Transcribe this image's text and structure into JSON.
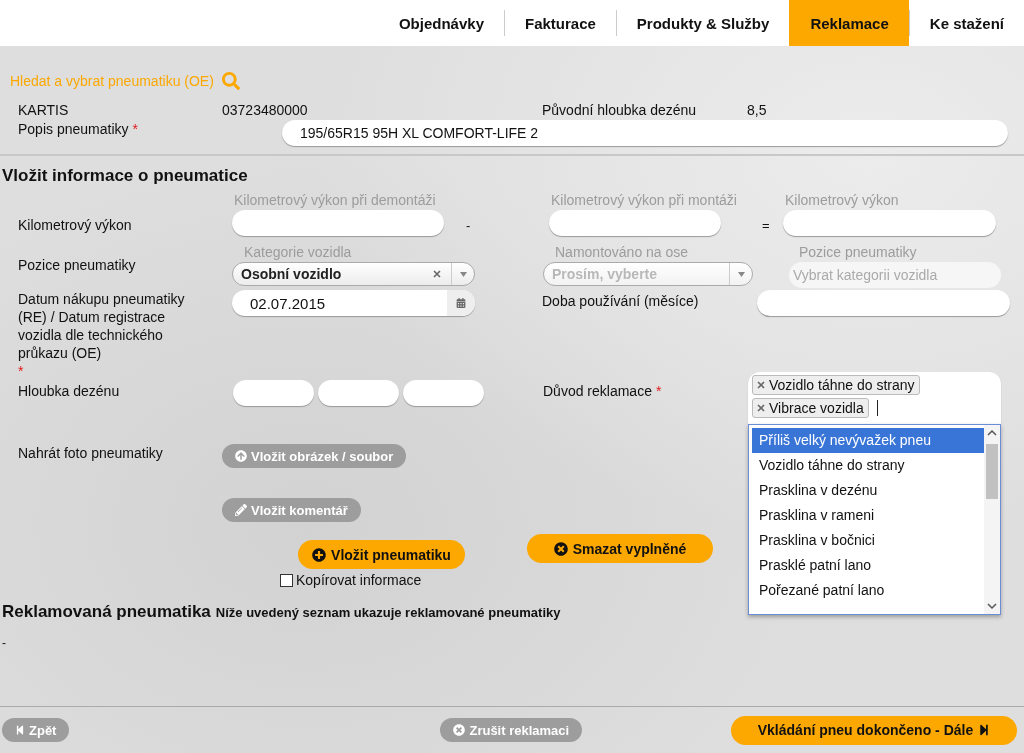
{
  "nav": {
    "tabs": [
      {
        "label": "Objednávky",
        "selected": false
      },
      {
        "label": "Fakturace",
        "selected": false
      },
      {
        "label": "Produkty & Služby",
        "selected": false
      },
      {
        "label": "Reklamace",
        "selected": true
      },
      {
        "label": "Ke stažení",
        "selected": false
      }
    ]
  },
  "search": {
    "label": "Hledat a vybrat pneumatiku (OE)"
  },
  "tire": {
    "kartis": {
      "label": "KARTIS",
      "value": "03723480000"
    },
    "original_depth": {
      "label": "Původní hloubka dezénu",
      "value": "8,5"
    },
    "description": {
      "label": "Popis pneumatiky",
      "marker": "*",
      "value": "195/65R15 95H XL COMFORT-LIFE 2"
    }
  },
  "form": {
    "title": "Vložit informace o pneumatice",
    "mileage": {
      "label": "Kilometrový výkon",
      "fields": [
        {
          "caption": "Kilometrový výkon při demontáži"
        },
        {
          "caption": "Kilometrový výkon při montáži"
        },
        {
          "caption": "Kilometrový výkon"
        }
      ],
      "operators": [
        "-",
        "="
      ]
    },
    "position": {
      "label": "Pozice pneumatiky",
      "selects": [
        {
          "caption": "Kategorie vozidla",
          "value": "Osobní vozidlo",
          "disabled": false
        },
        {
          "caption": "Namontováno na ose",
          "placeholder": "Prosím, vyberte",
          "disabled": true
        }
      ],
      "position_field": {
        "caption": "Pozice pneumatiky",
        "placeholder": "Vybrat kategorii vozidla"
      }
    },
    "purchase_date": {
      "label": "Datum nákupu pneumatiky (RE) / Datum registrace vozidla dle technického průkazu (OE)",
      "marker": "*",
      "value": "02.07.2015"
    },
    "usage": {
      "label": "Doba používání (měsíce)"
    },
    "tread_depth": {
      "label": "Hloubka dezénu"
    },
    "reason": {
      "label": "Důvod reklamace",
      "marker": "*",
      "tags": [
        "Vozidlo táhne do strany",
        "Vibrace vozidla"
      ],
      "options": [
        {
          "label": "Příliš velký nevývažek pneu",
          "selected": true
        },
        {
          "label": "Vozidlo táhne do strany",
          "selected": false
        },
        {
          "label": "Prasklina v dezénu",
          "selected": false
        },
        {
          "label": "Prasklina v rameni",
          "selected": false
        },
        {
          "label": "Prasklina v bočnici",
          "selected": false
        },
        {
          "label": "Prasklé patní lano",
          "selected": false
        },
        {
          "label": "Pořezané patní lano",
          "selected": false
        }
      ]
    },
    "photo": {
      "label": "Nahrát foto pneumatiky",
      "button": "Vložit obrázek / soubor"
    },
    "comment_button": "Vložit komentář",
    "add_button": "Vložit pneumatiku",
    "clear_button": "Smazat vyplněné",
    "copy": {
      "label": "Kopírovat informace",
      "checked": false
    }
  },
  "claimed": {
    "title": "Reklamovaná pneumatika",
    "subtitle": "Níže uvedený seznam ukazuje reklamované pneumatiky",
    "content": "-"
  },
  "footer": {
    "back": "Zpět",
    "cancel": "Zrušit reklamaci",
    "next": "Vkládání pneu dokončeno - Dále"
  }
}
